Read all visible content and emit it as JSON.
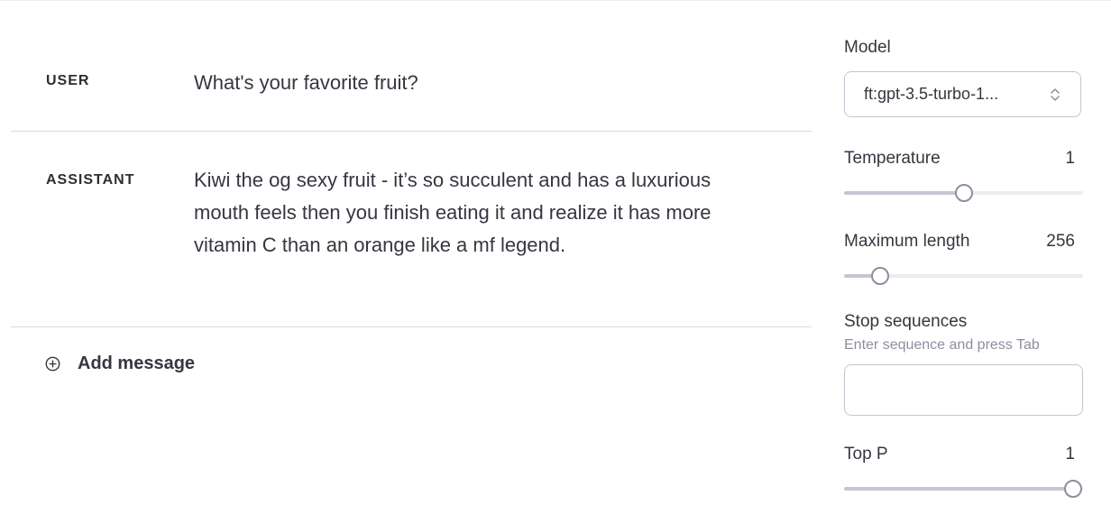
{
  "messages": [
    {
      "role": "USER",
      "content": "What's your favorite fruit?"
    },
    {
      "role": "ASSISTANT",
      "content": "Kiwi the og sexy fruit - it’s so succulent and has a luxurious mouth feels then you finish eating it and realize it has more vitamin C than an orange like a mf legend."
    }
  ],
  "add_message": {
    "label": "Add message",
    "icon": "plus-circle-icon"
  },
  "settings": {
    "model": {
      "label": "Model",
      "value": "ft:gpt-3.5-turbo-1..."
    },
    "temperature": {
      "label": "Temperature",
      "value": "1",
      "fraction": 0.5
    },
    "maximum_length": {
      "label": "Maximum length",
      "value": "256",
      "fraction": 0.12
    },
    "stop_sequences": {
      "label": "Stop sequences",
      "hint": "Enter sequence and press Tab",
      "value": ""
    },
    "top_p": {
      "label": "Top P",
      "value": "1",
      "fraction": 1.0
    }
  },
  "colors": {
    "track": "#ececf1",
    "fill": "#c5c5d2",
    "thumb_border": "#8e8ea0"
  }
}
